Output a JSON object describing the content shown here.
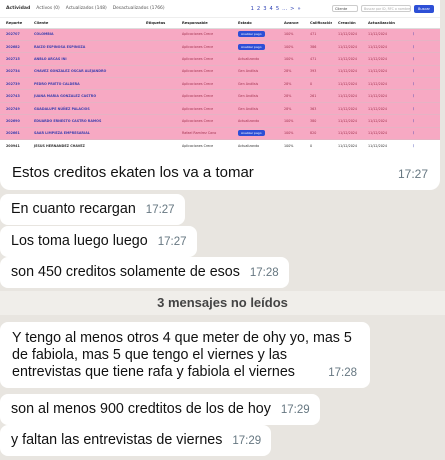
{
  "report": {
    "tabs": {
      "activity": "Actividad",
      "active": "Activos (0)",
      "updated": "Actualizados (148)",
      "outdated": "Desactualizados (1766)"
    },
    "pages": [
      "1",
      "2",
      "3",
      "4",
      "5",
      "...",
      ">",
      "»"
    ],
    "select_value": "Cliente",
    "search_placeholder": "Buscar por ID, RFC o nombre",
    "search_button": "Buscar",
    "columns": [
      "Reporte",
      "Cliente",
      "Etiquetas",
      "Responsable",
      "Estado",
      "Avance",
      "Calificación",
      "Creación",
      "Actualización",
      ""
    ],
    "rows": [
      {
        "id": "202707",
        "client": "COLOMBIA",
        "tags": "",
        "owner": "Aplicaciones Crece",
        "status": "Analizar pago",
        "status_badge": true,
        "progress": "100%",
        "score": "471",
        "created": "11/12/2024",
        "updated": "11/12/2024",
        "style": "pink"
      },
      {
        "id": "202682",
        "client": "RAIZO ESPINOSA ESPINOZA",
        "tags": "",
        "owner": "Aplicaciones Crece",
        "status": "Analizar pago",
        "status_badge": true,
        "progress": "100%",
        "score": "386",
        "created": "11/12/2024",
        "updated": "11/12/2024",
        "style": "pink"
      },
      {
        "id": "202715",
        "client": "ANBLO ARCAS INI",
        "tags": "",
        "owner": "Aplicaciones Crece",
        "status": "Actualizando",
        "status_badge": false,
        "progress": "100%",
        "score": "471",
        "created": "11/12/2024",
        "updated": "11/12/2024",
        "style": "pink"
      },
      {
        "id": "202734",
        "client": "CHAVEZ GONZALEZ OSCAR ALEJANDRO",
        "tags": "",
        "owner": "Aplicaciones Crece",
        "status": "Gen Análisis",
        "status_badge": false,
        "progress": "28%",
        "score": "393",
        "created": "11/12/2024",
        "updated": "11/12/2024",
        "style": "pink"
      },
      {
        "id": "202739",
        "client": "PEDRO PRIETO CALDERA",
        "tags": "",
        "owner": "Aplicaciones Crece",
        "status": "Gen Análisis",
        "status_badge": false,
        "progress": "28%",
        "score": "0",
        "created": "11/12/2024",
        "updated": "11/12/2024",
        "style": "pink"
      },
      {
        "id": "202743",
        "client": "JUANA MARIA GONZALEZ CASTRO",
        "tags": "",
        "owner": "Aplicaciones Crece",
        "status": "Gen Análisis",
        "status_badge": false,
        "progress": "28%",
        "score": "261",
        "created": "11/12/2024",
        "updated": "11/12/2024",
        "style": "pink"
      },
      {
        "id": "202749",
        "client": "GUADALUPE NÚÑEZ PALACIOS",
        "tags": "",
        "owner": "Aplicaciones Crece",
        "status": "Gen Análisis",
        "status_badge": false,
        "progress": "28%",
        "score": "363",
        "created": "11/12/2024",
        "updated": "11/12/2024",
        "style": "pink"
      },
      {
        "id": "202690",
        "client": "EDUARDO ERNESTO CASTRO RAMOS",
        "tags": "",
        "owner": "Aplicaciones Crece",
        "status": "Actualizando",
        "status_badge": false,
        "progress": "100%",
        "score": "380",
        "created": "11/12/2024",
        "updated": "11/12/2024",
        "style": "pink"
      },
      {
        "id": "202661",
        "client": "SAAR LIMPIEZA EMPRESARIAL",
        "tags": "",
        "owner": "Rafael Ramírez Cano",
        "status": "Analizar pago",
        "status_badge": true,
        "progress": "100%",
        "score": "820",
        "created": "11/12/2024",
        "updated": "11/12/2024",
        "style": "pink"
      },
      {
        "id": "200941",
        "client": "JESUS HERNANDEZ CHAVEZ",
        "tags": "",
        "owner": "Aplicaciones Crece",
        "status": "Actualizando",
        "status_badge": false,
        "progress": "100%",
        "score": "0",
        "created": "11/12/2024",
        "updated": "11/12/2024",
        "style": "white"
      }
    ],
    "row_menu_icon": "kebab-menu-icon"
  },
  "image_message": {
    "caption": "Estos creditos ekaten los va a tomar",
    "time": "17:27"
  },
  "messages": [
    {
      "text": "En cuanto recargan",
      "time": "17:27"
    },
    {
      "text": "Los toma luego luego",
      "time": "17:27"
    },
    {
      "text": "son 450 creditos solamente de esos",
      "time": "17:28"
    }
  ],
  "unread_banner": "3 mensajes no leídos",
  "long_message": {
    "text": "Y tengo al menos otros 4 que meter de ohy yo, mas 5 de fabiola, mas 5 que tengo el viernes y las entrevistas que tiene rafa y fabiola el viernes",
    "time": "17:28"
  },
  "messages_after": [
    {
      "text": "son al menos 900 credtitos de los de hoy",
      "time": "17:29"
    },
    {
      "text": "y faltan las entrevistas de viernes",
      "time": "17:29"
    }
  ],
  "colors": {
    "chat_bg": "#e8e5e0",
    "bubble": "#ffffff",
    "row_highlight": "#f7a9c3",
    "accent": "#2d4fd6",
    "timestamp": "#667781"
  }
}
